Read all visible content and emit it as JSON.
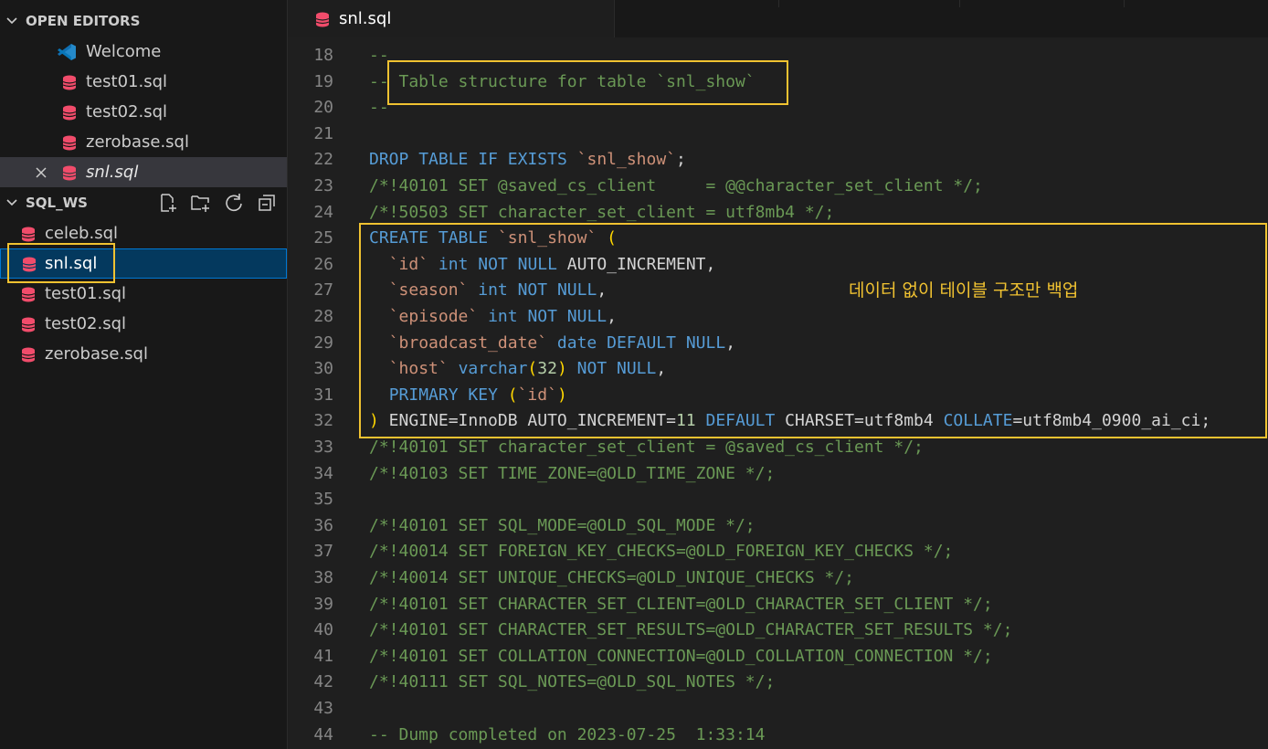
{
  "sidebar": {
    "open_editors": {
      "title": "OPEN EDITORS",
      "items": [
        {
          "label": "Welcome",
          "icon": "vscode-icon"
        },
        {
          "label": "test01.sql",
          "icon": "database-icon"
        },
        {
          "label": "test02.sql",
          "icon": "database-icon"
        },
        {
          "label": "zerobase.sql",
          "icon": "database-icon"
        },
        {
          "label": "snl.sql",
          "icon": "database-icon",
          "active": true
        }
      ]
    },
    "workspace": {
      "title": "SQL_WS",
      "files": [
        {
          "label": "celeb.sql"
        },
        {
          "label": "snl.sql",
          "selected": true
        },
        {
          "label": "test01.sql"
        },
        {
          "label": "test02.sql"
        },
        {
          "label": "zerobase.sql"
        }
      ]
    }
  },
  "tab": {
    "label": "snl.sql"
  },
  "editor": {
    "lines": [
      {
        "n": "18",
        "text": "--"
      },
      {
        "n": "19",
        "text": "-- Table structure for table `snl_show`"
      },
      {
        "n": "20",
        "text": "--"
      },
      {
        "n": "21",
        "text": ""
      },
      {
        "n": "22",
        "text": "DROP TABLE IF EXISTS `snl_show`;"
      },
      {
        "n": "23",
        "text": "/*!40101 SET @saved_cs_client     = @@character_set_client */;"
      },
      {
        "n": "24",
        "text": "/*!50503 SET character_set_client = utf8mb4 */;"
      },
      {
        "n": "25",
        "text": "CREATE TABLE `snl_show` ("
      },
      {
        "n": "26",
        "text": "  `id` int NOT NULL AUTO_INCREMENT,"
      },
      {
        "n": "27",
        "text": "  `season` int NOT NULL,"
      },
      {
        "n": "28",
        "text": "  `episode` int NOT NULL,"
      },
      {
        "n": "29",
        "text": "  `broadcast_date` date DEFAULT NULL,"
      },
      {
        "n": "30",
        "text": "  `host` varchar(32) NOT NULL,"
      },
      {
        "n": "31",
        "text": "  PRIMARY KEY (`id`)"
      },
      {
        "n": "32",
        "text": ") ENGINE=InnoDB AUTO_INCREMENT=11 DEFAULT CHARSET=utf8mb4 COLLATE=utf8mb4_0900_ai_ci;"
      },
      {
        "n": "33",
        "text": "/*!40101 SET character_set_client = @saved_cs_client */;"
      },
      {
        "n": "34",
        "text": "/*!40103 SET TIME_ZONE=@OLD_TIME_ZONE */;"
      },
      {
        "n": "35",
        "text": ""
      },
      {
        "n": "36",
        "text": "/*!40101 SET SQL_MODE=@OLD_SQL_MODE */;"
      },
      {
        "n": "37",
        "text": "/*!40014 SET FOREIGN_KEY_CHECKS=@OLD_FOREIGN_KEY_CHECKS */;"
      },
      {
        "n": "38",
        "text": "/*!40014 SET UNIQUE_CHECKS=@OLD_UNIQUE_CHECKS */;"
      },
      {
        "n": "39",
        "text": "/*!40101 SET CHARACTER_SET_CLIENT=@OLD_CHARACTER_SET_CLIENT */;"
      },
      {
        "n": "40",
        "text": "/*!40101 SET CHARACTER_SET_RESULTS=@OLD_CHARACTER_SET_RESULTS */;"
      },
      {
        "n": "41",
        "text": "/*!40101 SET COLLATION_CONNECTION=@OLD_COLLATION_CONNECTION */;"
      },
      {
        "n": "42",
        "text": "/*!40111 SET SQL_NOTES=@OLD_SQL_NOTES */;"
      },
      {
        "n": "43",
        "text": ""
      },
      {
        "n": "44",
        "text": "-- Dump completed on 2023-07-25  1:33:14"
      }
    ]
  },
  "annotation": {
    "note": "데이터 없이 테이블 구조만 백업"
  },
  "colors": {
    "highlight": "#f0c231",
    "comment": "#6a9955",
    "keyword": "#569cd6",
    "string": "#ce9178",
    "db_icon": "#f14c6b"
  }
}
